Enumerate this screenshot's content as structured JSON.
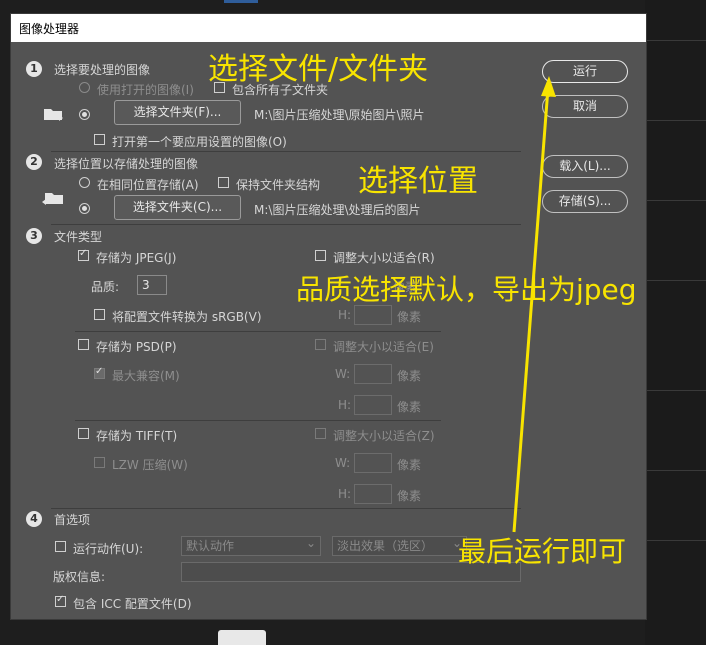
{
  "dialog": {
    "title": "图像处理器"
  },
  "section1": {
    "num": "1",
    "label": "选择要处理的图像",
    "use_open_label": "使用打开的图像(I)",
    "include_sub_label": "包含所有子文件夹",
    "select_folder_label": "选择文件夹(F)...",
    "folder_path": "M:\\图片压缩处理\\原始图片\\照片",
    "open_first_label": "打开第一个要应用设置的图像(O)"
  },
  "section2": {
    "num": "2",
    "label": "选择位置以存储处理的图像",
    "same_location_label": "在相同位置存储(A)",
    "keep_structure_label": "保持文件夹结构",
    "select_folder_label": "选择文件夹(C)...",
    "folder_path": "M:\\图片压缩处理\\处理后的图片"
  },
  "section3": {
    "num": "3",
    "label": "文件类型",
    "jpeg": {
      "save_label": "存储为 JPEG(J)",
      "resize_label": "调整大小以适合(R)",
      "quality_label": "品质:",
      "quality_value": "3",
      "srgb_label": "将配置文件转换为 sRGB(V)",
      "h_label": "H:",
      "px_label": "像素",
      "w_px_label": "像素"
    },
    "psd": {
      "save_label": "存储为 PSD(P)",
      "resize_label": "调整大小以适合(E)",
      "max_compat_label": "最大兼容(M)",
      "w_label": "W:",
      "h_label": "H:",
      "px_label": "像素"
    },
    "tiff": {
      "save_label": "存储为 TIFF(T)",
      "resize_label": "调整大小以适合(Z)",
      "lzw_label": "LZW 压缩(W)",
      "w_label": "W:",
      "h_label": "H:",
      "px_label": "像素"
    }
  },
  "section4": {
    "num": "4",
    "label": "首选项",
    "run_action_label": "运行动作(U):",
    "action_set": "默认动作",
    "action": "淡出效果（选区）",
    "copyright_label": "版权信息:",
    "copyright_value": "",
    "icc_label": "包含 ICC 配置文件(D)"
  },
  "buttons": {
    "run": "运行",
    "cancel": "取消",
    "load": "载入(L)...",
    "save": "存储(S)..."
  },
  "annotations": {
    "select_files": "选择文件/文件夹",
    "select_location": "选择位置",
    "quality_note": "品质选择默认，导出为jpeg",
    "run_note": "最后运行即可"
  },
  "colors": {
    "annotation": "#f8e400",
    "dialog_bg": "#535353",
    "title_bg": "#ffffff"
  }
}
